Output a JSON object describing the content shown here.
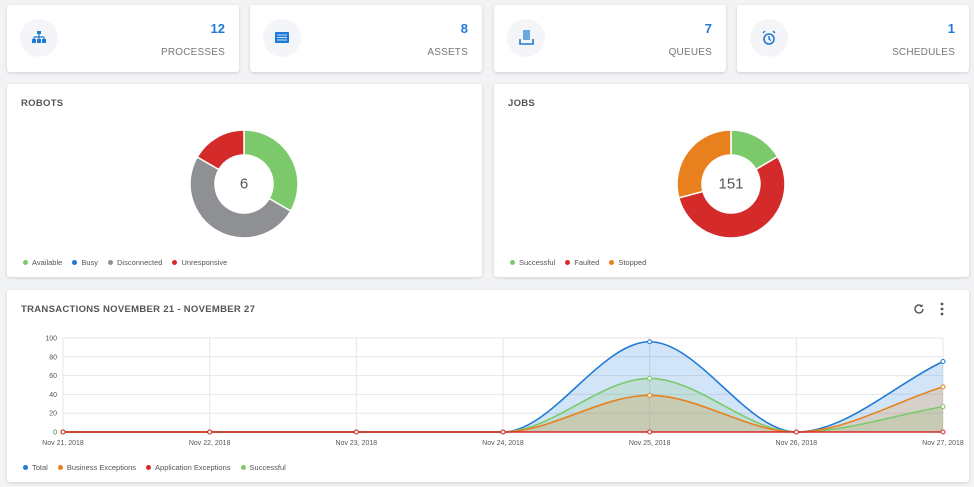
{
  "stats": [
    {
      "value": "12",
      "label": "PROCESSES",
      "icon": "sitemap-icon"
    },
    {
      "value": "8",
      "label": "ASSETS",
      "icon": "list-icon"
    },
    {
      "value": "7",
      "label": "QUEUES",
      "icon": "queue-icon"
    },
    {
      "value": "1",
      "label": "SCHEDULES",
      "icon": "alarm-clock-icon"
    }
  ],
  "accent": "#1f7ad6",
  "robots": {
    "title": "ROBOTS",
    "total": "6",
    "legend": [
      {
        "label": "Available",
        "color": "#7cc96b",
        "value": 2
      },
      {
        "label": "Busy",
        "color": "#1f7ad6",
        "value": 0
      },
      {
        "label": "Disconnected",
        "color": "#8e9093",
        "value": 3
      },
      {
        "label": "Unresponsive",
        "color": "#d42a2a",
        "value": 1
      }
    ]
  },
  "jobs": {
    "title": "JOBS",
    "total": "151",
    "legend": [
      {
        "label": "Successful",
        "color": "#7cc96b",
        "value": 25
      },
      {
        "label": "Faulted",
        "color": "#d42a2a",
        "value": 82
      },
      {
        "label": "Stopped",
        "color": "#e8801e",
        "value": 44
      }
    ]
  },
  "transactions": {
    "title": "TRANSACTIONS NOVEMBER 21 - NOVEMBER 27"
  },
  "chart_data": {
    "type": "area",
    "x": [
      "Nov 21, 2018",
      "Nov 22, 2018",
      "Nov 23, 2018",
      "Nov 24, 2018",
      "Nov 25, 2018",
      "Nov 26, 2018",
      "Nov 27, 2018"
    ],
    "yticks": [
      0,
      20,
      40,
      60,
      80,
      100
    ],
    "ylim": [
      0,
      100
    ],
    "grid": true,
    "legend_position": "bottom-left",
    "series": [
      {
        "name": "Total",
        "color": "#1f7ad6",
        "values": [
          0,
          0,
          0,
          0,
          96,
          0,
          75
        ]
      },
      {
        "name": "Business Exceptions",
        "color": "#e8801e",
        "values": [
          0,
          0,
          0,
          0,
          39,
          0,
          48
        ]
      },
      {
        "name": "Application Exceptions",
        "color": "#d42a2a",
        "values": [
          0,
          0,
          0,
          0,
          0,
          0,
          0
        ]
      },
      {
        "name": "Successful",
        "color": "#7cc96b",
        "values": [
          0,
          0,
          0,
          0,
          57,
          0,
          27
        ]
      }
    ]
  }
}
